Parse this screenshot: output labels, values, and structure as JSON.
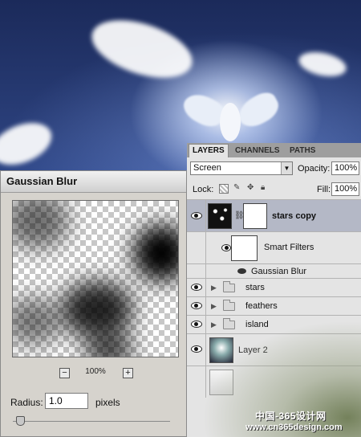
{
  "gaussian_blur": {
    "title": "Gaussian Blur",
    "zoom_minus": "−",
    "zoom_plus": "+",
    "zoom_level": "100%",
    "radius_label": "Radius:",
    "radius_value": "1.0",
    "radius_unit": "pixels",
    "slider_level": 0.05
  },
  "layers_panel": {
    "tabs": [
      "LAYERS",
      "CHANNELS",
      "PATHS"
    ],
    "active_tab": "LAYERS",
    "blend_mode": "Screen",
    "opacity_label": "Opacity:",
    "opacity_value": "100%",
    "lock_label": "Lock:",
    "fill_label": "Fill:",
    "fill_value": "100%",
    "layers": [
      {
        "name": "stars copy",
        "visible": true,
        "selected": true
      },
      {
        "name": "Smart Filters",
        "visible": true
      },
      {
        "name": "Gaussian Blur",
        "visible": true
      },
      {
        "name": "stars",
        "visible": true,
        "type": "group"
      },
      {
        "name": "feathers",
        "visible": true,
        "type": "group"
      },
      {
        "name": "island",
        "visible": true,
        "type": "group"
      },
      {
        "name": "Layer 2",
        "visible": true
      }
    ]
  },
  "watermark": {
    "line1": "中国-365设计网",
    "line2": "www.cn365design.com"
  },
  "colors": {
    "selected_row": "#b4b8c6",
    "panel_bg": "#e4e4e4",
    "dialog_bg": "#d6d3cd"
  }
}
